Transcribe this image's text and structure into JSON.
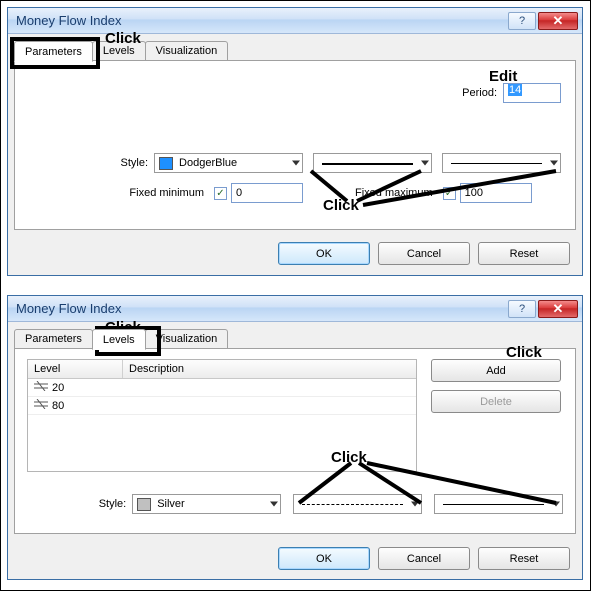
{
  "annotations": {
    "click": "Click",
    "edit": "Edit"
  },
  "dialog1": {
    "title": "Money Flow Index",
    "tabs": {
      "parameters": "Parameters",
      "levels": "Levels",
      "visualization": "Visualization"
    },
    "period_label": "Period:",
    "period_value": "14",
    "style_label": "Style:",
    "color_name": "DodgerBlue",
    "color_hex": "#1e90ff",
    "fixed_min_label": "Fixed minimum",
    "fixed_min_checked": true,
    "fixed_min_value": "0",
    "fixed_max_label": "Fixed maximum",
    "fixed_max_checked": true,
    "fixed_max_value": "100",
    "buttons": {
      "ok": "OK",
      "cancel": "Cancel",
      "reset": "Reset"
    }
  },
  "dialog2": {
    "title": "Money Flow Index",
    "tabs": {
      "parameters": "Parameters",
      "levels": "Levels",
      "visualization": "Visualization"
    },
    "columns": {
      "level": "Level",
      "description": "Description"
    },
    "rows": [
      {
        "level": "20",
        "description": ""
      },
      {
        "level": "80",
        "description": ""
      }
    ],
    "add": "Add",
    "delete": "Delete",
    "style_label": "Style:",
    "color_name": "Silver",
    "color_hex": "#c0c0c0",
    "buttons": {
      "ok": "OK",
      "cancel": "Cancel",
      "reset": "Reset"
    }
  }
}
